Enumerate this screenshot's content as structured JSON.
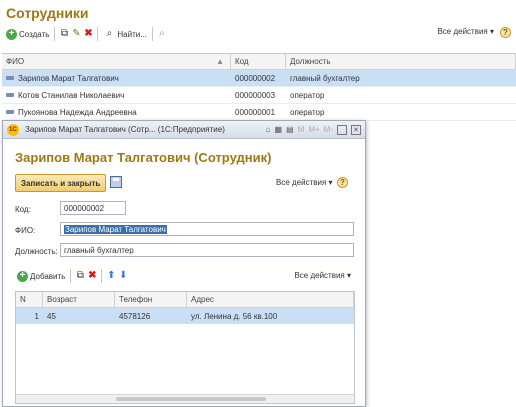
{
  "list": {
    "title": "Сотрудники",
    "toolbar": {
      "create_label": "Создать",
      "find_label": "Найти...",
      "all_actions": "Все действия ▾"
    },
    "columns": [
      "ФИО",
      "Код",
      "Должность"
    ],
    "rows": [
      {
        "fio": "Зарипов Марат Талгатович",
        "code": "000000002",
        "position": "главный бухгалтер"
      },
      {
        "fio": "Котов Станилав Николаевич",
        "code": "000000003",
        "position": "оператор"
      },
      {
        "fio": "Пукоянова Надежда Андреевна",
        "code": "000000001",
        "position": "оператор"
      }
    ]
  },
  "modal": {
    "window_title": "Зарипов Марат Талгатович (Сотр...   (1С:Предприятие)",
    "window_buttons": {
      "m": "M",
      "mplus": "M+",
      "mminus": "M-"
    },
    "heading": "Зарипов Марат Талгатович (Сотрудник)",
    "save_close_label": "Записать и закрыть",
    "all_actions": "Все действия ▾",
    "fields": {
      "code_label": "Код:",
      "code_value": "000000002",
      "fio_label": "ФИО:",
      "fio_value": "Зарипов Марат Талгатович",
      "position_label": "Должность:",
      "position_value": "главный бухгалтер"
    },
    "table_toolbar": {
      "add_label": "Добавить",
      "all_actions": "Все действия ▾"
    },
    "table_columns": [
      "N",
      "Возраст",
      "Телефон",
      "Адрес"
    ],
    "table_rows": [
      {
        "n": "1",
        "age": "45",
        "phone": "4578126",
        "address": "ул. Ленина д. 56 кв.100"
      }
    ]
  },
  "colors": {
    "accent_title": "#9a7a17",
    "selection": "#c9dff5",
    "button": "#f0cd6e"
  },
  "icons": [
    "add-icon",
    "copy-icon",
    "edit-icon",
    "delete-icon",
    "search-icon",
    "help-icon",
    "save-icon",
    "move-up-icon",
    "move-down-icon"
  ]
}
